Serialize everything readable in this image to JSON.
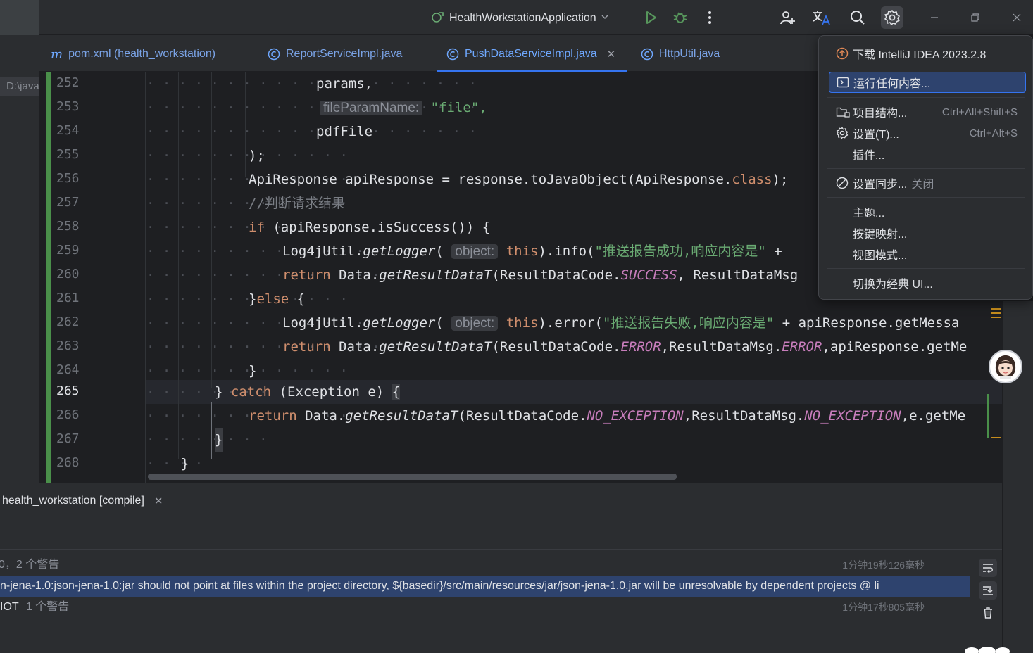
{
  "titlebar": {
    "run_config": "HealthWorkstationApplication"
  },
  "tabs": [
    {
      "label": "pom.xml (health_workstation)",
      "icon": "maven-m-icon"
    },
    {
      "label": "ReportServiceImpl.java",
      "icon": "class-icon"
    },
    {
      "label": "PushDataServiceImpl.java",
      "icon": "class-icon",
      "active": true
    },
    {
      "label": "HttpUtil.java",
      "icon": "class-icon"
    }
  ],
  "left_panel": {
    "path_chip": "D:\\java"
  },
  "editor": {
    "line_numbers": [
      "252",
      "253",
      "254",
      "255",
      "256",
      "257",
      "258",
      "259",
      "260",
      "261",
      "262",
      "263",
      "264",
      "265",
      "266",
      "267",
      "268"
    ],
    "current_line": "265",
    "lines": {
      "l252": "params,",
      "l253_hint": "fileParamName:",
      "l253": "\"file\",",
      "l254": "pdfFile",
      "l255": ");",
      "l256a": "ApiResponse apiResponse = response.toJavaObject(ApiResponse.",
      "l256b": "class",
      "l256c": ");",
      "l257": "//判断请求结果",
      "l258a": "if",
      "l258b": " (apiResponse.isSuccess()) {",
      "l259a": "Log4jUtil.",
      "l259b": "getLogger",
      "l259c": "(",
      "l259_hint": "object:",
      "l259d": "this",
      "l259e": ").info(",
      "l259f": "\"推送报告成功,响应内容是\"",
      "l259g": " +",
      "l260a": "return",
      "l260b": " Data.",
      "l260c": "getResultDataT",
      "l260d": "(ResultDataCode.",
      "l260e": "SUCCESS",
      "l260f": ", ResultDataMsg",
      "l261a": "}",
      "l261b": "else",
      "l261c": " {",
      "l262a": "Log4jUtil.",
      "l262b": "getLogger",
      "l262c": "(",
      "l262_hint": "object:",
      "l262d": "this",
      "l262e": ").error(",
      "l262f": "\"推送报告失败,响应内容是\"",
      "l262g": " + apiResponse.getMessa",
      "l263a": "return",
      "l263b": " Data.",
      "l263c": "getResultDataT",
      "l263d": "(ResultDataCode.",
      "l263e": "ERROR",
      "l263f": ",ResultDataMsg.",
      "l263g": "ERROR",
      "l263h": ",apiResponse.getMe",
      "l264": "}",
      "l265a": "} ",
      "l265b": "catch",
      "l265c": " (Exception e) ",
      "l265d": "{",
      "l266a": "return",
      "l266b": " Data.",
      "l266c": "getResultDataT",
      "l266d": "(ResultDataCode.",
      "l266e": "NO_EXCEPTION",
      "l266f": ",ResultDataMsg.",
      "l266g": "NO_EXCEPTION",
      "l266h": ",e.getMe",
      "l267": "}",
      "l268": "}"
    }
  },
  "menu": {
    "items": [
      {
        "label": "下载 IntelliJ IDEA 2023.2.8",
        "icon": "update-arrow-icon"
      },
      {
        "label": "运行任何内容...",
        "icon": "run-anything-icon",
        "selected": true
      },
      {
        "label": "项目结构...",
        "shortcut": "Ctrl+Alt+Shift+S",
        "icon": "folder-icon"
      },
      {
        "label": "设置(T)...",
        "shortcut": "Ctrl+Alt+S",
        "icon": "gear-icon"
      },
      {
        "label": "插件..."
      },
      {
        "label": "设置同步...",
        "suffix": "关闭",
        "icon": "sync-off-icon"
      },
      {
        "label": "主题..."
      },
      {
        "label": "按键映射..."
      },
      {
        "label": "视图模式..."
      },
      {
        "label": "切换为经典 UI..."
      }
    ]
  },
  "bottom": {
    "tab_label": "health_workstation [compile]",
    "lines": [
      {
        "text": "0，2 个警告",
        "time": "1分钟19秒126毫秒"
      },
      {
        "text": "n-jena-1.0:json-jena-1.0:jar should not point at files within the project directory, ${basedir}/src/main/resources/jar/json-jena-1.0.jar will be unresolvable by dependent projects @ li"
      },
      {
        "text_a": "IOT",
        "text_b": "1 个警告",
        "time": "1分钟17秒805毫秒"
      }
    ]
  },
  "colors": {
    "accent": "#3574f0",
    "keyword": "#cf8e6d",
    "string": "#6aab73",
    "function": "#56a8f5",
    "constant": "#c77dbb",
    "vcs_added": "#4a8f4a"
  }
}
